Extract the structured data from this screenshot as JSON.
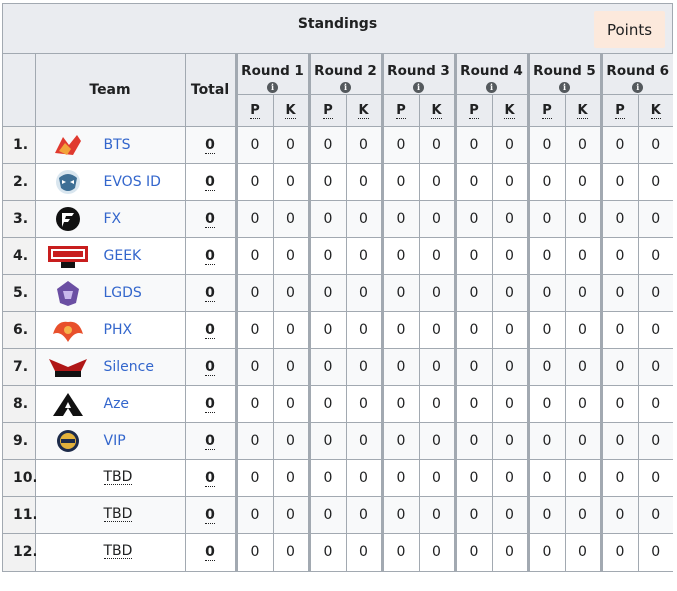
{
  "header": {
    "title": "Standings",
    "points_button": "Points"
  },
  "columns": {
    "team": "Team",
    "total": "Total",
    "p": "P",
    "k": "K",
    "info_icon": "info-icon",
    "rounds": [
      "Round 1",
      "Round 2",
      "Round 3",
      "Round 4",
      "Round 5",
      "Round 6"
    ]
  },
  "rows": [
    {
      "rank": "1.",
      "team": "BTS",
      "logo": "bts-logo",
      "total": "0",
      "values": [
        "0",
        "0",
        "0",
        "0",
        "0",
        "0",
        "0",
        "0",
        "0",
        "0",
        "0",
        "0"
      ]
    },
    {
      "rank": "2.",
      "team": "EVOS ID",
      "logo": "evos-logo",
      "total": "0",
      "values": [
        "0",
        "0",
        "0",
        "0",
        "0",
        "0",
        "0",
        "0",
        "0",
        "0",
        "0",
        "0"
      ]
    },
    {
      "rank": "3.",
      "team": "FX",
      "logo": "fx-logo",
      "total": "0",
      "values": [
        "0",
        "0",
        "0",
        "0",
        "0",
        "0",
        "0",
        "0",
        "0",
        "0",
        "0",
        "0"
      ]
    },
    {
      "rank": "4.",
      "team": "GEEK",
      "logo": "geek-logo",
      "total": "0",
      "values": [
        "0",
        "0",
        "0",
        "0",
        "0",
        "0",
        "0",
        "0",
        "0",
        "0",
        "0",
        "0"
      ]
    },
    {
      "rank": "5.",
      "team": "LGDS",
      "logo": "lgds-logo",
      "total": "0",
      "values": [
        "0",
        "0",
        "0",
        "0",
        "0",
        "0",
        "0",
        "0",
        "0",
        "0",
        "0",
        "0"
      ]
    },
    {
      "rank": "6.",
      "team": "PHX",
      "logo": "phx-logo",
      "total": "0",
      "values": [
        "0",
        "0",
        "0",
        "0",
        "0",
        "0",
        "0",
        "0",
        "0",
        "0",
        "0",
        "0"
      ]
    },
    {
      "rank": "7.",
      "team": "Silence",
      "logo": "silence-logo",
      "total": "0",
      "values": [
        "0",
        "0",
        "0",
        "0",
        "0",
        "0",
        "0",
        "0",
        "0",
        "0",
        "0",
        "0"
      ]
    },
    {
      "rank": "8.",
      "team": "Aze",
      "logo": "aze-logo",
      "total": "0",
      "values": [
        "0",
        "0",
        "0",
        "0",
        "0",
        "0",
        "0",
        "0",
        "0",
        "0",
        "0",
        "0"
      ]
    },
    {
      "rank": "9.",
      "team": "VIP",
      "logo": "vip-logo",
      "total": "0",
      "values": [
        "0",
        "0",
        "0",
        "0",
        "0",
        "0",
        "0",
        "0",
        "0",
        "0",
        "0",
        "0"
      ]
    },
    {
      "rank": "10.",
      "team": "TBD",
      "logo": "",
      "total": "0",
      "values": [
        "0",
        "0",
        "0",
        "0",
        "0",
        "0",
        "0",
        "0",
        "0",
        "0",
        "0",
        "0"
      ]
    },
    {
      "rank": "11.",
      "team": "TBD",
      "logo": "",
      "total": "0",
      "values": [
        "0",
        "0",
        "0",
        "0",
        "0",
        "0",
        "0",
        "0",
        "0",
        "0",
        "0",
        "0"
      ]
    },
    {
      "rank": "12.",
      "team": "TBD",
      "logo": "",
      "total": "0",
      "values": [
        "0",
        "0",
        "0",
        "0",
        "0",
        "0",
        "0",
        "0",
        "0",
        "0",
        "0",
        "0"
      ]
    }
  ],
  "colors": {
    "header_bg": "#eaecf0",
    "border": "#a2a9b1",
    "link": "#3366cc",
    "points_bg": "#fce9dc"
  }
}
